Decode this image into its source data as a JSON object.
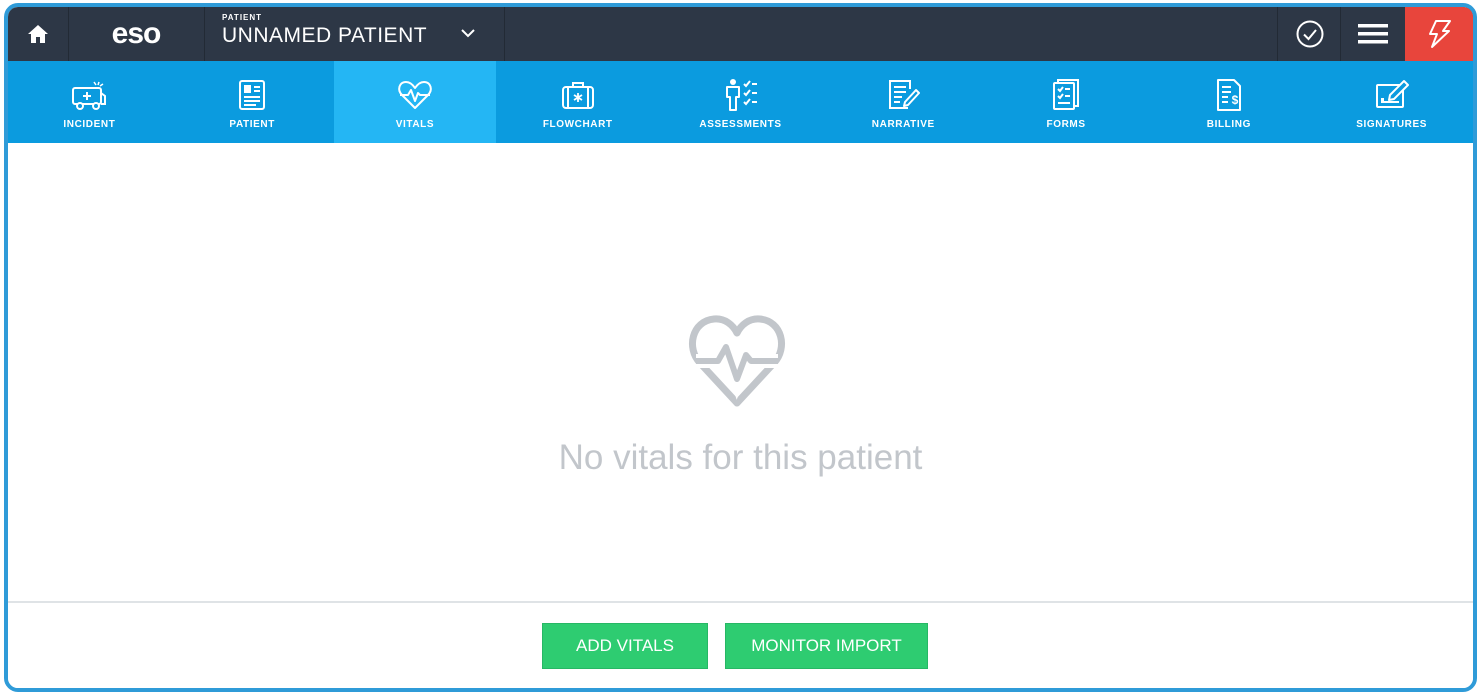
{
  "app": {
    "logo_text": "eso",
    "patient_caption": "PATIENT",
    "patient_name": "UNNAMED PATIENT"
  },
  "topbar": {
    "icons": [
      "home-icon",
      "chevron-down-icon",
      "check-circle-icon",
      "hamburger-menu-icon",
      "lightning-alert-icon"
    ]
  },
  "nav": {
    "active": "VITALS",
    "tabs": [
      {
        "label": "INCIDENT",
        "icon": "ambulance-icon"
      },
      {
        "label": "PATIENT",
        "icon": "patient-card-icon"
      },
      {
        "label": "VITALS",
        "icon": "heart-pulse-icon"
      },
      {
        "label": "FLOWCHART",
        "icon": "medical-bag-icon"
      },
      {
        "label": "ASSESSMENTS",
        "icon": "body-checklist-icon"
      },
      {
        "label": "NARRATIVE",
        "icon": "document-pencil-icon"
      },
      {
        "label": "FORMS",
        "icon": "forms-checklist-icon"
      },
      {
        "label": "BILLING",
        "icon": "billing-document-icon"
      },
      {
        "label": "SIGNATURES",
        "icon": "signature-icon"
      }
    ]
  },
  "empty_state": {
    "icon": "heart-pulse-icon",
    "message": "No vitals for this patient"
  },
  "footer": {
    "add_vitals_label": "ADD VITALS",
    "monitor_import_label": "MONITOR IMPORT"
  },
  "colors": {
    "topbar": "#2d3746",
    "nav": "#0b9bdf",
    "nav_active": "#24b6f4",
    "alert": "#e8453c",
    "button_green": "#2ecc71",
    "frame_border": "#2f9bd8"
  }
}
